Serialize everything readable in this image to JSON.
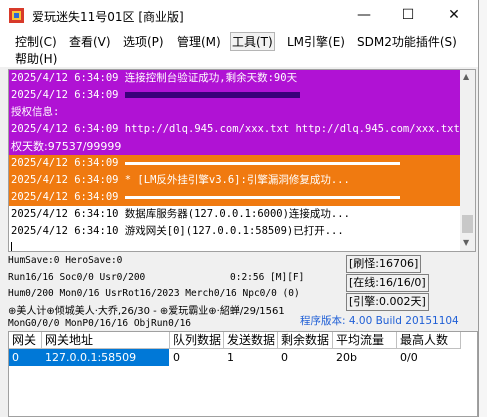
{
  "window": {
    "title": "爱玩迷失11号01区 [商业版]"
  },
  "controls": {
    "minimize": "—",
    "maximize": "☐",
    "close": "✕"
  },
  "menu": [
    {
      "label": "控制(C)"
    },
    {
      "label": "查看(V)"
    },
    {
      "label": "选项(P)"
    },
    {
      "label": "管理(M)"
    },
    {
      "label": "工具(T)"
    },
    {
      "label": "LM引擎(E)"
    },
    {
      "label": "SDM2功能插件(S)"
    },
    {
      "label": "帮助(H)"
    }
  ],
  "log": [
    {
      "style": "purple",
      "text": "2025/4/12 6:34:09 连接控制台验证成功,剩余天数:90天"
    },
    {
      "style": "purple",
      "text": "2025/4/12 6:34:09 ",
      "bar": true
    },
    {
      "style": "purple",
      "text": "授权信息:"
    },
    {
      "style": "purple",
      "text": "2025/4/12 6:34:09 http://dlq.945.com/xxx.txt http://dlq.945.com/xxx.txt 授"
    },
    {
      "style": "purple",
      "text": "权天数:97537/99999",
      "cont": true
    },
    {
      "style": "orange",
      "text": "2025/4/12 6:34:09 ",
      "bar": true
    },
    {
      "style": "orange",
      "text": "2025/4/12 6:34:09 * [LM反外挂引擎v3.6]:引擎漏洞修复成功..."
    },
    {
      "style": "orange",
      "text": "2025/4/12 6:34:09 ",
      "bar": true
    },
    {
      "style": "plain",
      "text": "2025/4/12 6:34:10 数据库服务器(127.0.0.1:6000)连接成功..."
    },
    {
      "style": "plain",
      "text": "2025/4/12 6:34:10 游戏网关[0](127.0.0.1:58509)已打开..."
    }
  ],
  "stats": {
    "line1": "HumSave:0 HeroSave:0",
    "line2": "Run16/16 Soc0/0 Usr0/200",
    "time": "0:2:56 [M][F]",
    "line3": "Hum0/200 Mon0/16 UsrRot16/2023 Merch0/16 Npc0/0 (0)",
    "line4": "⊕美人计⊕倾城美人·大乔,26/30 - ⊕爱玩霸业⊕·紹蝉/29/1561",
    "line5": "MonG0/0/0 MonP0/16/16 ObjRun0/16",
    "refresh": "[刷怪:16706]",
    "online": "[在线:16/16/0]",
    "engine": "[引擎:0.002天]",
    "version": "程序版本: 4.00 Build 20151104"
  },
  "table": {
    "headers": [
      "网关",
      "网关地址",
      "队列数据",
      "发送数据",
      "剩余数据",
      "平均流量",
      "最高人数"
    ],
    "rows": [
      [
        "0",
        "127.0.0.1:58509",
        "0",
        "1",
        "0",
        "20b",
        "0/0"
      ]
    ]
  }
}
